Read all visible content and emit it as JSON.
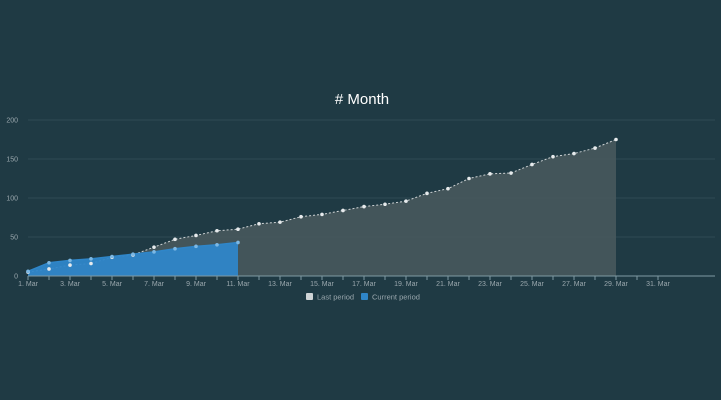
{
  "chart_data": {
    "type": "area",
    "title": "# Month",
    "xlabel": "",
    "ylabel": "",
    "x": [
      "1. Mar",
      "2. Mar",
      "3. Mar",
      "4. Mar",
      "5. Mar",
      "6. Mar",
      "7. Mar",
      "8. Mar",
      "9. Mar",
      "10. Mar",
      "11. Mar",
      "12. Mar",
      "13. Mar",
      "14. Mar",
      "15. Mar",
      "16. Mar",
      "17. Mar",
      "18. Mar",
      "19. Mar",
      "20. Mar",
      "21. Mar",
      "22. Mar",
      "23. Mar",
      "24. Mar",
      "25. Mar",
      "26. Mar",
      "27. Mar",
      "28. Mar",
      "29. Mar",
      "30. Mar",
      "31. Mar"
    ],
    "x_tick_labels": [
      "1. Mar",
      "3. Mar",
      "5. Mar",
      "7. Mar",
      "9. Mar",
      "11. Mar",
      "13. Mar",
      "15. Mar",
      "17. Mar",
      "19. Mar",
      "21. Mar",
      "23. Mar",
      "25. Mar",
      "27. Mar",
      "29. Mar",
      "31. Mar"
    ],
    "y_ticks": [
      0,
      50,
      100,
      150,
      200
    ],
    "ylim": [
      0,
      200
    ],
    "grid": true,
    "legend_position": "bottom-center",
    "series": [
      {
        "name": "Last period",
        "color": "#cfd4d6",
        "fill": "#4a5a5e",
        "values": [
          5,
          9,
          14,
          16,
          24,
          27,
          37,
          47,
          52,
          58,
          60,
          67,
          69,
          76,
          79,
          84,
          89,
          92,
          96,
          106,
          112,
          125,
          131,
          132,
          143,
          153,
          157,
          164,
          175
        ]
      },
      {
        "name": "Current period",
        "color": "#2f86c9",
        "fill": "#2f86c9",
        "values": [
          6,
          17,
          20,
          22,
          25,
          28,
          31,
          35,
          38,
          40,
          43
        ]
      }
    ]
  }
}
